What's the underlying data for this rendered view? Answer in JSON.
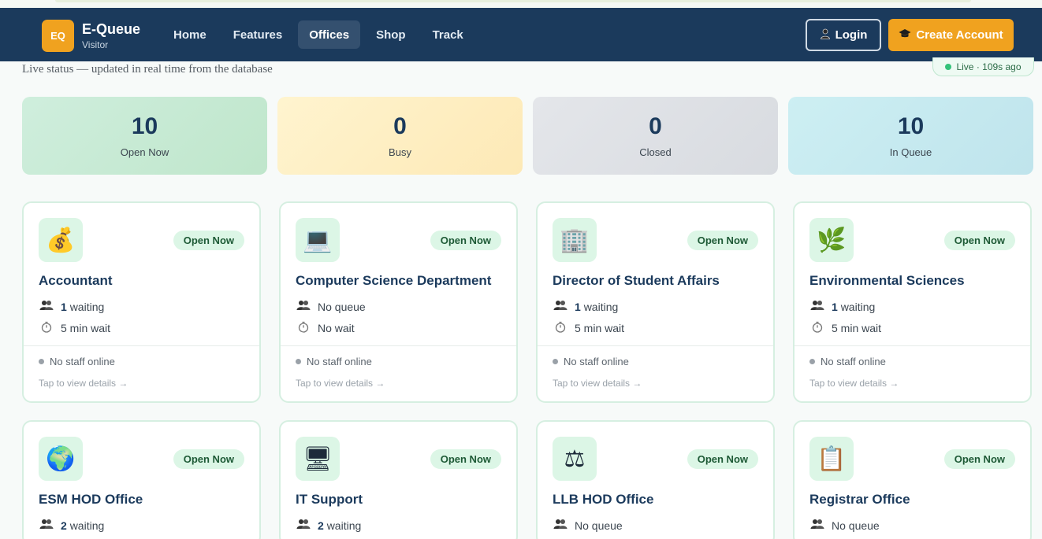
{
  "brand": {
    "logo": "EQ",
    "name": "E-Queue",
    "role": "Visitor"
  },
  "nav": {
    "items": [
      {
        "label": "Home",
        "active": false
      },
      {
        "label": "Features",
        "active": false
      },
      {
        "label": "Offices",
        "active": true
      },
      {
        "label": "Shop",
        "active": false
      },
      {
        "label": "Track",
        "active": false
      }
    ],
    "login_label": "Login",
    "create_label": "Create Account"
  },
  "status_line": "Live status — updated in real time from the database",
  "live_pill": "Live · 109s ago",
  "stats": [
    {
      "value": "10",
      "label": "Open Now"
    },
    {
      "value": "0",
      "label": "Busy"
    },
    {
      "value": "0",
      "label": "Closed"
    },
    {
      "value": "10",
      "label": "In Queue"
    }
  ],
  "offices": [
    {
      "icon": "money-bag-icon",
      "glyph": "💰",
      "badge": "Open Now",
      "title": "Accountant",
      "count": "1",
      "queue_text": "waiting",
      "wait": "5 min wait",
      "staff": "No staff online",
      "tap": "Tap to view details →"
    },
    {
      "icon": "laptop-icon",
      "glyph": "💻",
      "badge": "Open Now",
      "title": "Computer Science Department",
      "count": "",
      "queue_text": "No queue",
      "wait": "No wait",
      "staff": "No staff online",
      "tap": "Tap to view details →"
    },
    {
      "icon": "office-building-icon",
      "glyph": "🏢",
      "badge": "Open Now",
      "title": "Director of Student Affairs",
      "count": "1",
      "queue_text": "waiting",
      "wait": "5 min wait",
      "staff": "No staff online",
      "tap": "Tap to view details →"
    },
    {
      "icon": "herb-icon",
      "glyph": "🌿",
      "badge": "Open Now",
      "title": "Environmental Sciences",
      "count": "1",
      "queue_text": "waiting",
      "wait": "5 min wait",
      "staff": "No staff online",
      "tap": "Tap to view details →"
    },
    {
      "icon": "globe-icon",
      "glyph": "🌍",
      "badge": "Open Now",
      "title": "ESM HOD Office",
      "count": "2",
      "queue_text": "waiting"
    },
    {
      "icon": "desktop-computer-icon",
      "glyph": "🖥",
      "badge": "Open Now",
      "title": "IT Support",
      "count": "2",
      "queue_text": "waiting"
    },
    {
      "icon": "scales-icon",
      "glyph": "⚖",
      "badge": "Open Now",
      "title": "LLB HOD Office",
      "count": "",
      "queue_text": "No queue"
    },
    {
      "icon": "clipboard-icon",
      "glyph": "📋",
      "badge": "Open Now",
      "title": "Registrar Office",
      "count": "",
      "queue_text": "No queue"
    }
  ],
  "colors": {
    "nav_bg": "#1b3a5c",
    "accent": "#f0a21f",
    "open_green": "#dcf6e6"
  }
}
